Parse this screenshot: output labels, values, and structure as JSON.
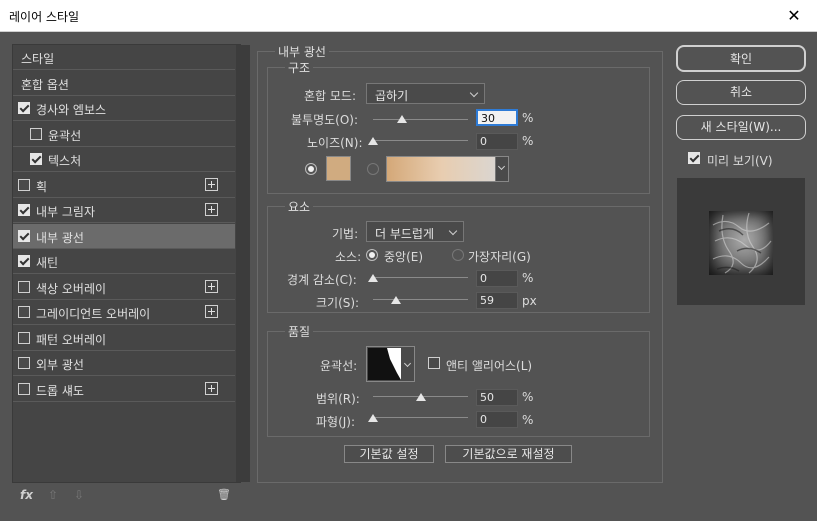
{
  "window": {
    "title": "레이어 스타일",
    "close": "✕"
  },
  "sidebar": {
    "items": [
      {
        "label": "스타일",
        "has_checkbox": false,
        "checked": false,
        "has_plus": false,
        "selected": false,
        "indent": 0
      },
      {
        "label": "혼합 옵션",
        "has_checkbox": false,
        "checked": false,
        "has_plus": false,
        "selected": false,
        "indent": 0
      },
      {
        "label": "경사와 엠보스",
        "has_checkbox": true,
        "checked": true,
        "has_plus": false,
        "selected": false,
        "indent": 0
      },
      {
        "label": "윤곽선",
        "has_checkbox": true,
        "checked": false,
        "has_plus": false,
        "selected": false,
        "indent": 1
      },
      {
        "label": "텍스처",
        "has_checkbox": true,
        "checked": true,
        "has_plus": false,
        "selected": false,
        "indent": 1
      },
      {
        "label": "획",
        "has_checkbox": true,
        "checked": false,
        "has_plus": true,
        "selected": false,
        "indent": 0
      },
      {
        "label": "내부 그림자",
        "has_checkbox": true,
        "checked": true,
        "has_plus": true,
        "selected": false,
        "indent": 0
      },
      {
        "label": "내부 광선",
        "has_checkbox": true,
        "checked": true,
        "has_plus": false,
        "selected": true,
        "indent": 0
      },
      {
        "label": "새틴",
        "has_checkbox": true,
        "checked": true,
        "has_plus": false,
        "selected": false,
        "indent": 0
      },
      {
        "label": "색상 오버레이",
        "has_checkbox": true,
        "checked": false,
        "has_plus": true,
        "selected": false,
        "indent": 0
      },
      {
        "label": "그레이디언트 오버레이",
        "has_checkbox": true,
        "checked": false,
        "has_plus": true,
        "selected": false,
        "indent": 0
      },
      {
        "label": "패턴 오버레이",
        "has_checkbox": true,
        "checked": false,
        "has_plus": false,
        "selected": false,
        "indent": 0
      },
      {
        "label": "외부 광선",
        "has_checkbox": true,
        "checked": false,
        "has_plus": false,
        "selected": false,
        "indent": 0
      },
      {
        "label": "드롭 섀도",
        "has_checkbox": true,
        "checked": false,
        "has_plus": true,
        "selected": false,
        "indent": 0
      }
    ],
    "bottom": {
      "fx": "fx",
      "up": "⇧",
      "down": "⇩",
      "trash": "🗑"
    }
  },
  "panel": {
    "title": "내부 광선",
    "structure": {
      "title": "구조",
      "blend_mode_label": "혼합 모드:",
      "blend_mode_value": "곱하기",
      "opacity_label": "불투명도(O):",
      "opacity_value": "30",
      "opacity_unit": "%",
      "opacity_level": 30,
      "noise_label": "노이즈(N):",
      "noise_value": "0",
      "noise_unit": "%",
      "noise_level": 0,
      "color_swatch": "#d0ab80"
    },
    "elements": {
      "title": "요소",
      "technique_label": "기법:",
      "technique_value": "더 부드럽게",
      "source_label": "소스:",
      "source_center": "중앙(E)",
      "source_edge": "가장자리(G)",
      "choke_label": "경계 감소(C):",
      "choke_value": "0",
      "choke_unit": "%",
      "choke_level": 0,
      "size_label": "크기(S):",
      "size_value": "59",
      "size_unit": "px",
      "size_level": 24
    },
    "quality": {
      "title": "품질",
      "contour_label": "윤곽선:",
      "antialias_label": "앤티 앨리어스(L)",
      "range_label": "범위(R):",
      "range_value": "50",
      "range_unit": "%",
      "range_level": 50,
      "jitter_label": "파형(J):",
      "jitter_value": "0",
      "jitter_unit": "%",
      "jitter_level": 0
    },
    "buttons": {
      "make_default": "기본값 설정",
      "reset_default": "기본값으로 재설정"
    }
  },
  "right": {
    "ok": "확인",
    "cancel": "취소",
    "new_style": "새 스타일(W)...",
    "preview_label": "미리 보기(V)",
    "preview_checked": true
  }
}
